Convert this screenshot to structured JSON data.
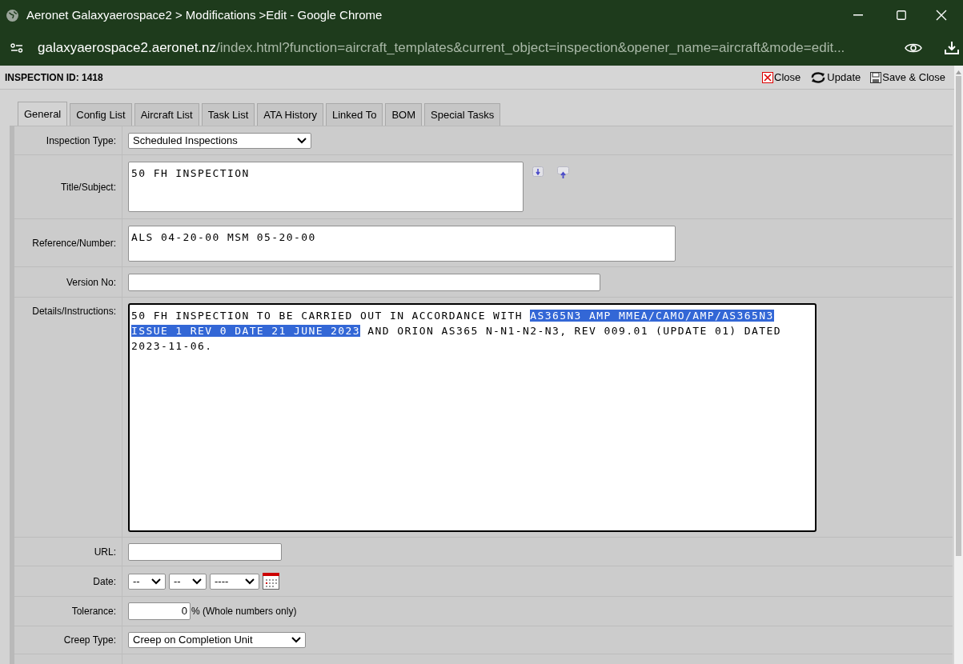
{
  "window": {
    "title": "Aeronet Galaxyaerospace2 > Modifications >Edit - Google Chrome"
  },
  "address_bar": {
    "host": "galaxyaerospace2.aeronet.nz",
    "path": "/index.html?function=aircraft_templates&current_object=inspection&opener_name=aircraft&mode=edit..."
  },
  "header": {
    "title": "INSPECTION ID: 1418",
    "actions": [
      {
        "kind": "close",
        "label": "Close"
      },
      {
        "kind": "update",
        "label": "Update"
      },
      {
        "kind": "save",
        "label": "Save & Close"
      }
    ]
  },
  "tabs": [
    {
      "label": "General",
      "selected": true
    },
    {
      "label": "Config List",
      "selected": false
    },
    {
      "label": "Aircraft List",
      "selected": false
    },
    {
      "label": "Task List",
      "selected": false
    },
    {
      "label": "ATA History",
      "selected": false
    },
    {
      "label": "Linked To",
      "selected": false
    },
    {
      "label": "BOM",
      "selected": false
    },
    {
      "label": "Special Tasks",
      "selected": false
    }
  ],
  "form": [
    {
      "kind": "select",
      "label": "Inspection Type:",
      "value": "Scheduled Inspections"
    },
    {
      "kind": "title",
      "label": "Title/Subject:",
      "value": "50 FH INSPECTION"
    },
    {
      "kind": "textarea",
      "label": "Reference/Number:",
      "value": "ALS 04-20-00 MSM 05-20-00"
    },
    {
      "kind": "text",
      "label": "Version No:"
    },
    {
      "kind": "details",
      "label": "Details/Instructions:",
      "text_before": "50 FH INSPECTION TO BE CARRIED OUT IN ACCORDANCE WITH ",
      "selected_text": "AS365N3 AMP MMEA/CAMO/AMP/AS365N3 ISSUE 1 REV 0 DATE 21 JUNE 2023",
      "text_after": " AND ORION AS365 N-N1-N2-N3, REV 009.01 (UPDATE 01) DATED 2023-11-06."
    },
    {
      "kind": "url",
      "label": "URL:"
    },
    {
      "kind": "date",
      "label": "Date:",
      "day": "--",
      "month": "--",
      "year": "----"
    },
    {
      "kind": "tolerance",
      "label": "Tolerance:",
      "value": "0",
      "note": "% (Whole numbers only)"
    },
    {
      "kind": "creep",
      "label": "Creep Type:",
      "value": "Creep on Completion Unit"
    }
  ]
}
